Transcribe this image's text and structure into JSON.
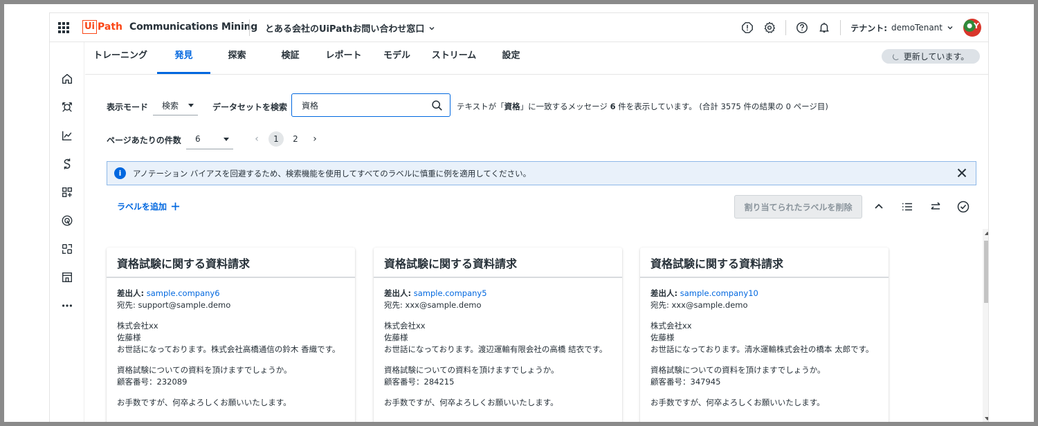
{
  "header": {
    "logo_ui": "Ui",
    "logo_path": "Path",
    "product_name": "Communications Mining",
    "project_name": "とある会社のUiPathお問い合わせ窓口",
    "tenant_label": "テナント:",
    "tenant_value": "demoTenant",
    "avatar_letter": "Y"
  },
  "tabs": [
    {
      "label": "トレーニング"
    },
    {
      "label": "発見"
    },
    {
      "label": "探索"
    },
    {
      "label": "検証"
    },
    {
      "label": "レポート"
    },
    {
      "label": "モデル"
    },
    {
      "label": "ストリーム"
    },
    {
      "label": "設定"
    }
  ],
  "active_tab": "発見",
  "status_pill": "更新しています。",
  "filters": {
    "mode_label": "表示モード",
    "mode_value": "検索",
    "dataset_search_label": "データセットを検索",
    "search_value": "資格",
    "per_page_label": "ページあたりの件数",
    "per_page_value": "6"
  },
  "result": {
    "prefix": "テキストが「",
    "term": "資格",
    "middle": "」に一致するメッセージ",
    "count": "6",
    "suffix": "件を表示しています。 (合計 3575 件の結果の 0 ページ目)"
  },
  "pager": {
    "prev": "‹",
    "pages": [
      "1",
      "2"
    ],
    "next": "›"
  },
  "info_banner": "アノテーション バイアスを回避するため、検索機能を使用してすべてのラベルに慎重に例を適用してください。",
  "actions": {
    "add_label": "ラベルを追加",
    "remove_assigned": "割り当てられたラベルを削除"
  },
  "cards": [
    {
      "title": "資格試験に関する資料請求",
      "from_label": "差出人:",
      "from": "sample.company6",
      "to": "宛先: support@sample.demo",
      "line1": "株式会社xx",
      "line2": "佐藤様",
      "line3": "お世話になっております。株式会社高橋通信の鈴木 香織です。",
      "line4": "資格試験についての資料を頂けますでしょうか。",
      "line5": "顧客番号：232089",
      "line6": "お手数ですが、何卒よろしくお願いいたします。"
    },
    {
      "title": "資格試験に関する資料請求",
      "from_label": "差出人:",
      "from": "sample.company5",
      "to": "宛先: xxx@sample.demo",
      "line1": "株式会社xx",
      "line2": "佐藤様",
      "line3": "お世話になっております。渡辺運輸有限会社の高橋 結衣です。",
      "line4": "資格試験についての資料を頂けますでしょうか。",
      "line5": "顧客番号：284215",
      "line6": "お手数ですが、何卒よろしくお願いいたします。"
    },
    {
      "title": "資格試験に関する資料請求",
      "from_label": "差出人:",
      "from": "sample.company10",
      "to": "宛先: xxx@sample.demo",
      "line1": "株式会社xx",
      "line2": "佐藤様",
      "line3": "お世話になっております。清水運輸株式会社の橋本 太郎です。",
      "line4": "資格試験についての資料を頂けますでしょうか。",
      "line5": "顧客番号：347945",
      "line6": "お手数ですが、何卒よろしくお願いいたします。"
    }
  ],
  "colors": {
    "accent": "#0067df",
    "brand": "#fa4616",
    "text": "#273139",
    "banner_bg": "#e9f1fa"
  },
  "icons": {
    "apps": "apps-grid-icon",
    "alert": "alert-icon",
    "settings": "gear-icon",
    "help": "help-icon",
    "notifications": "bell-icon",
    "search": "search-icon",
    "info": "info-icon",
    "close": "close-icon"
  }
}
